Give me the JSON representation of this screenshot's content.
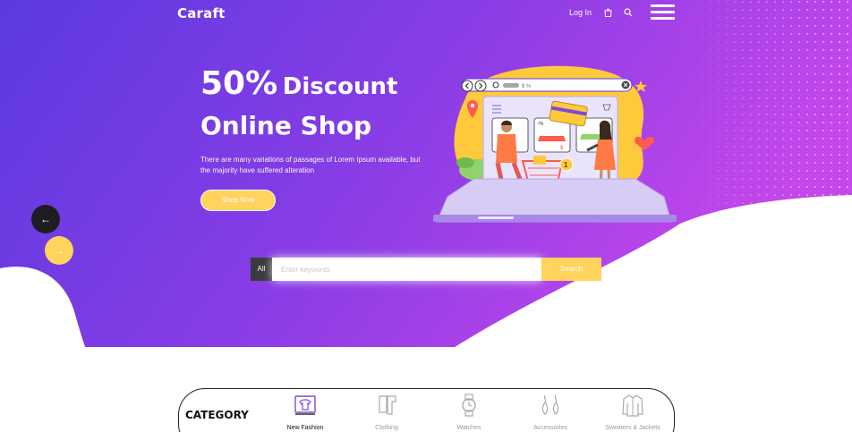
{
  "brand": {
    "name": "Caraft"
  },
  "nav": {
    "login_label": "Log In",
    "icons": [
      "shopping-bag-icon",
      "search-icon",
      "hamburger-menu-icon"
    ]
  },
  "hero": {
    "headline_big": "50%",
    "headline_rest": "Discount",
    "headline_line2": "Online Shop",
    "description": "There are many variations of passages of Lorem Ipsum available, but the majority have suffered alteration",
    "cta_label": "Shop Now",
    "illustration_labels": {
      "browser_percent": "$ %",
      "discount": "-%",
      "price": "$",
      "badge": "1"
    }
  },
  "slider": {
    "prev_label": "←",
    "next_label": "→"
  },
  "search": {
    "category_label": "All",
    "placeholder": "Enter keywords",
    "button_label": "Search"
  },
  "categories": {
    "title": "CATEGORY",
    "items": [
      {
        "label": "New Fashion",
        "icon": "fashion-icon",
        "active": true
      },
      {
        "label": "Clothing",
        "icon": "clothing-icon",
        "active": false
      },
      {
        "label": "Watches",
        "icon": "watch-icon",
        "active": false
      },
      {
        "label": "Accessories",
        "icon": "earrings-icon",
        "active": false
      },
      {
        "label": "Sweaters & Jackets",
        "icon": "jacket-icon",
        "active": false
      }
    ]
  },
  "colors": {
    "gradient_start": "#5b3ae0",
    "gradient_mid": "#8c3de6",
    "gradient_end": "#c447ea",
    "accent_yellow": "#ffd35c",
    "dark": "#1e1e22"
  }
}
